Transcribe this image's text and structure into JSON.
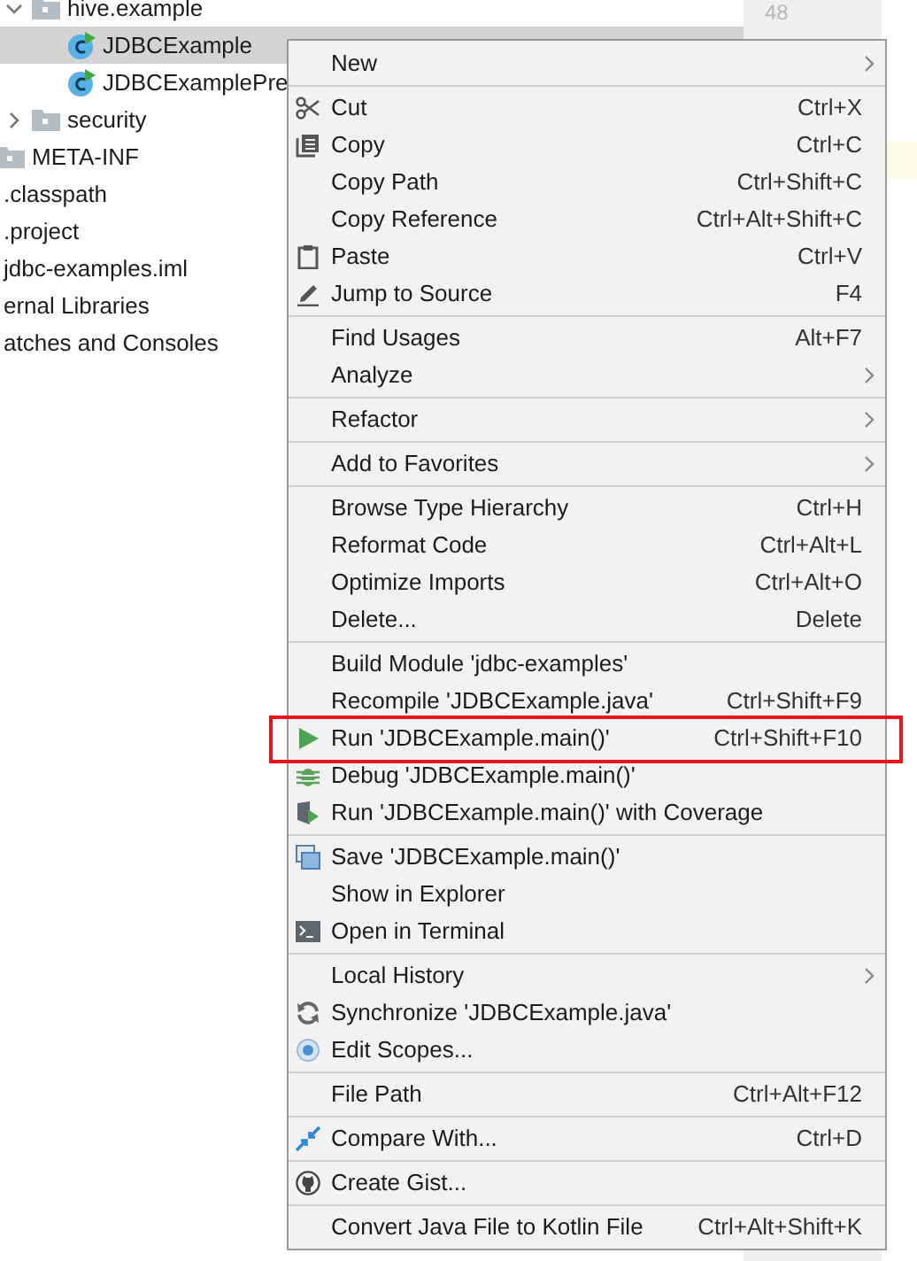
{
  "tree": [
    {
      "label": "hive.example",
      "kind": "folder",
      "expanded": true,
      "selected": false,
      "children": [
        {
          "label": "JDBCExample",
          "kind": "class",
          "selected": true
        },
        {
          "label": "JDBCExamplePre",
          "kind": "class",
          "selected": false
        }
      ]
    },
    {
      "label": "security",
      "kind": "folder",
      "expanded": false,
      "selected": false
    }
  ],
  "outer_folders": [
    {
      "label": "META-INF",
      "kind": "folder"
    }
  ],
  "root_items": [
    {
      "label": ".classpath"
    },
    {
      "label": ".project"
    },
    {
      "label": "jdbc-examples.iml"
    },
    {
      "label": "ernal Libraries"
    },
    {
      "label": "atches and Consoles"
    }
  ],
  "gutter": {
    "line_number": "48"
  },
  "menu": {
    "sections": [
      [
        {
          "label": "New",
          "kind": "plain",
          "submenu": true,
          "annotated": false
        }
      ],
      [
        {
          "label": "Cut",
          "kind": "cut",
          "shortcut": "Ctrl+X",
          "submenu": false,
          "annotated": false
        },
        {
          "label": "Copy",
          "kind": "copy",
          "shortcut": "Ctrl+C",
          "submenu": false,
          "annotated": false
        },
        {
          "label": "Copy Path",
          "kind": "plain",
          "shortcut": "Ctrl+Shift+C",
          "submenu": false,
          "annotated": false
        },
        {
          "label": "Copy Reference",
          "kind": "plain",
          "shortcut": "Ctrl+Alt+Shift+C",
          "submenu": false,
          "annotated": false
        },
        {
          "label": "Paste",
          "kind": "paste",
          "shortcut": "Ctrl+V",
          "submenu": false,
          "annotated": false
        },
        {
          "label": "Jump to Source",
          "kind": "edit",
          "shortcut": "F4",
          "submenu": false,
          "annotated": false
        }
      ],
      [
        {
          "label": "Find Usages",
          "kind": "plain",
          "shortcut": "Alt+F7",
          "submenu": false,
          "annotated": false
        },
        {
          "label": "Analyze",
          "kind": "plain",
          "submenu": true,
          "annotated": false
        }
      ],
      [
        {
          "label": "Refactor",
          "kind": "plain",
          "submenu": true,
          "annotated": false
        }
      ],
      [
        {
          "label": "Add to Favorites",
          "kind": "plain",
          "submenu": true,
          "annotated": false
        }
      ],
      [
        {
          "label": "Browse Type Hierarchy",
          "kind": "plain",
          "shortcut": "Ctrl+H",
          "submenu": false,
          "annotated": false
        },
        {
          "label": "Reformat Code",
          "kind": "plain",
          "shortcut": "Ctrl+Alt+L",
          "submenu": false,
          "annotated": false
        },
        {
          "label": "Optimize Imports",
          "kind": "plain",
          "shortcut": "Ctrl+Alt+O",
          "submenu": false,
          "annotated": false
        },
        {
          "label": "Delete...",
          "kind": "plain",
          "shortcut": "Delete",
          "submenu": false,
          "annotated": false
        }
      ],
      [
        {
          "label": "Build Module 'jdbc-examples'",
          "kind": "plain",
          "submenu": false,
          "annotated": false
        },
        {
          "label": "Recompile 'JDBCExample.java'",
          "kind": "plain",
          "shortcut": "Ctrl+Shift+F9",
          "submenu": false,
          "annotated": false
        },
        {
          "label": "Run 'JDBCExample.main()'",
          "kind": "run",
          "shortcut": "Ctrl+Shift+F10",
          "submenu": false,
          "annotated": true
        },
        {
          "label": "Debug 'JDBCExample.main()'",
          "kind": "debug",
          "submenu": false,
          "annotated": false
        },
        {
          "label": "Run 'JDBCExample.main()' with Coverage",
          "kind": "coverage",
          "submenu": false,
          "annotated": false
        }
      ],
      [
        {
          "label": "Save 'JDBCExample.main()'",
          "kind": "save",
          "submenu": false,
          "annotated": false
        },
        {
          "label": "Show in Explorer",
          "kind": "plain",
          "submenu": false,
          "annotated": false
        },
        {
          "label": "Open in Terminal",
          "kind": "terminal",
          "submenu": false,
          "annotated": false
        }
      ],
      [
        {
          "label": "Local History",
          "kind": "plain",
          "submenu": true,
          "annotated": false
        },
        {
          "label": "Synchronize 'JDBCExample.java'",
          "kind": "sync",
          "submenu": false,
          "annotated": false
        },
        {
          "label": "Edit Scopes...",
          "kind": "scope",
          "submenu": false,
          "annotated": false
        }
      ],
      [
        {
          "label": "File Path",
          "kind": "plain",
          "shortcut": "Ctrl+Alt+F12",
          "submenu": false,
          "annotated": false
        }
      ],
      [
        {
          "label": "Compare With...",
          "kind": "compare",
          "shortcut": "Ctrl+D",
          "submenu": false,
          "annotated": false
        }
      ],
      [
        {
          "label": "Create Gist...",
          "kind": "gist",
          "submenu": false,
          "annotated": false
        }
      ],
      [
        {
          "label": "Convert Java File to Kotlin File",
          "kind": "plain",
          "shortcut": "Ctrl+Alt+Shift+K",
          "submenu": false,
          "annotated": false
        }
      ]
    ]
  }
}
